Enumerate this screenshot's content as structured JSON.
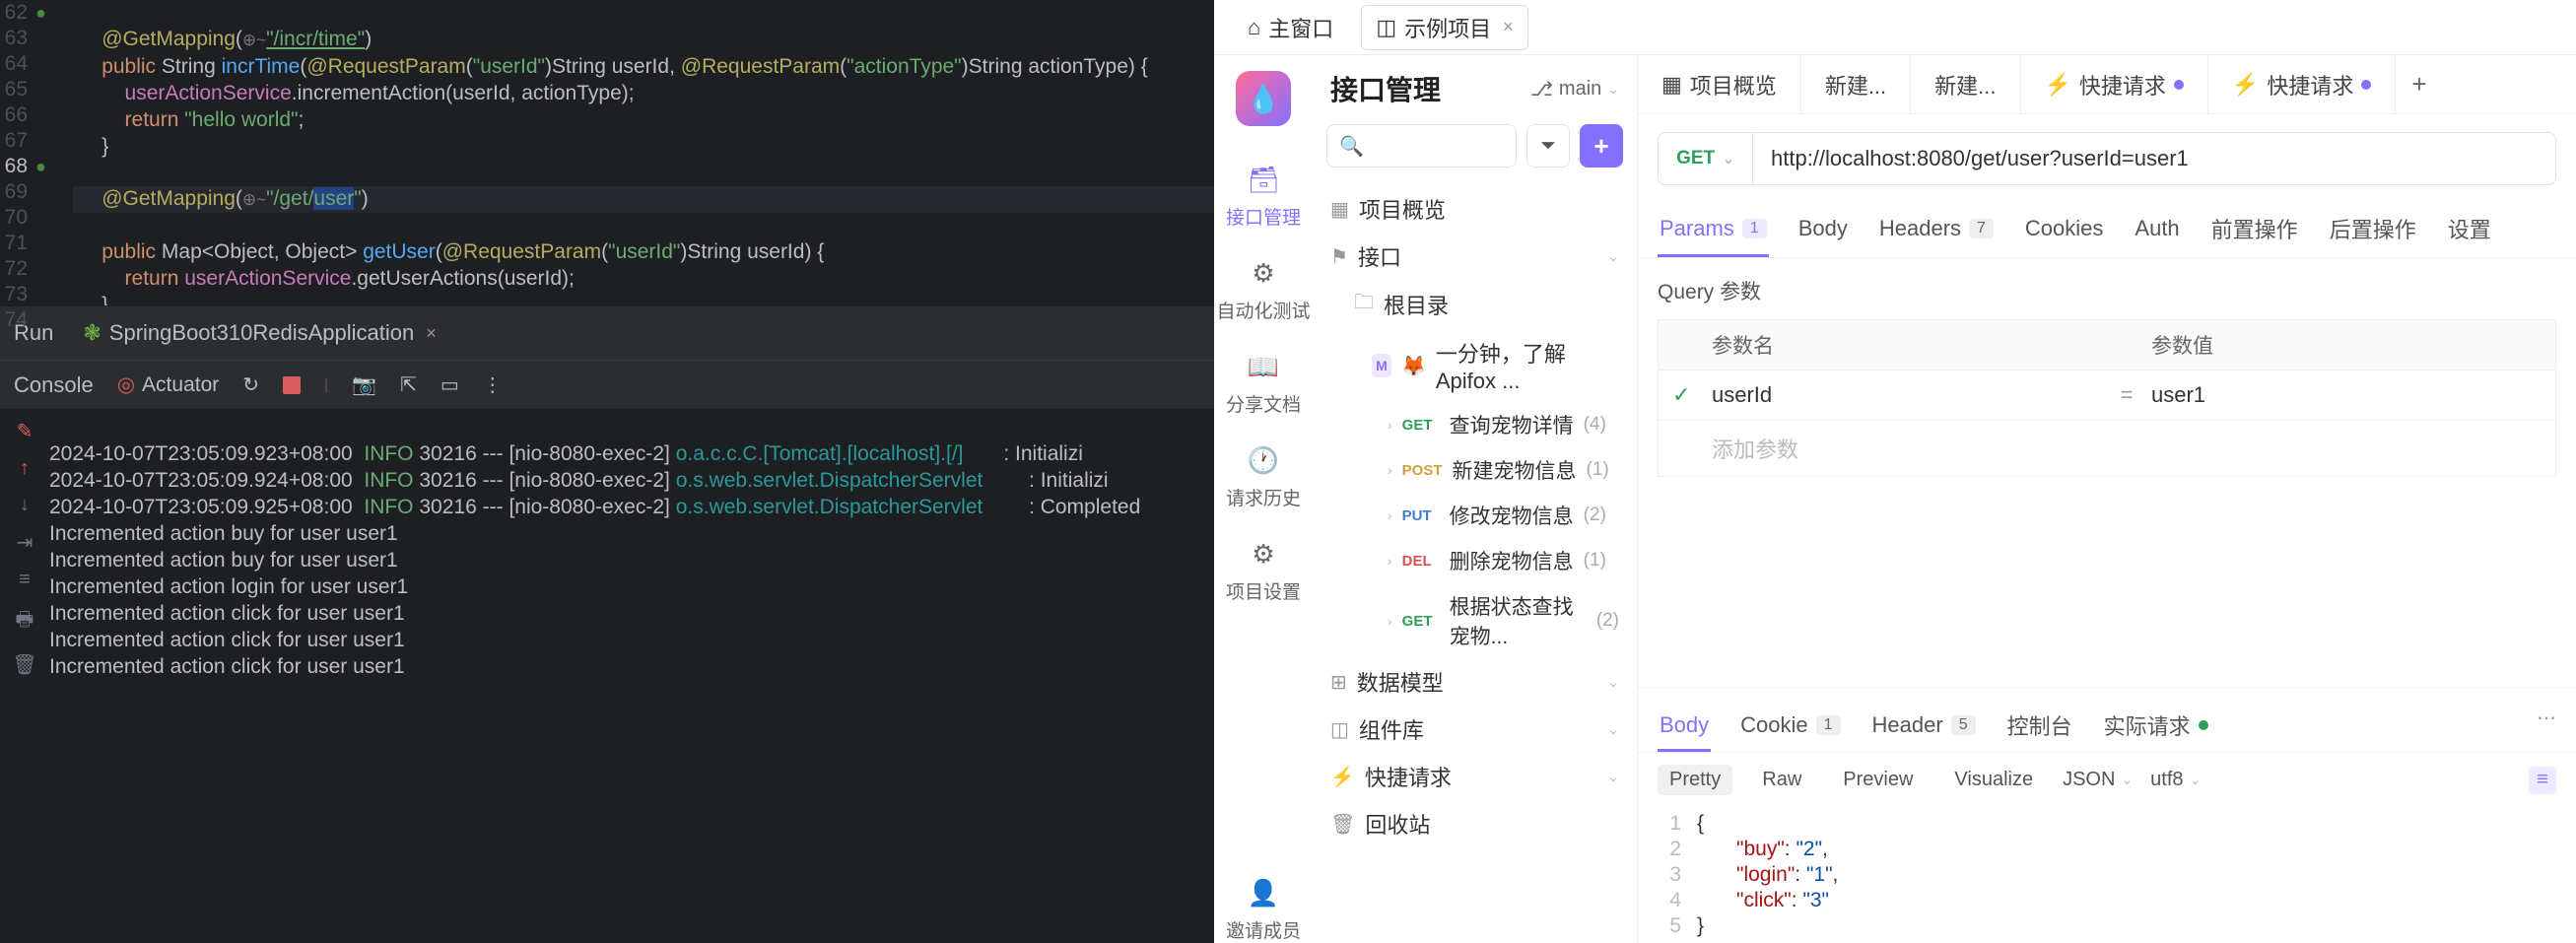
{
  "editor": {
    "lines": [
      "62",
      "63",
      "64",
      "65",
      "66",
      "67",
      "68",
      "69",
      "70",
      "71",
      "72",
      "73",
      "74"
    ],
    "code": {
      "l62": {
        "ann": "@GetMapping",
        "hint": "⊕~",
        "path": "\"/incr/time\""
      },
      "l63": {
        "kw1": "public",
        "type": "String",
        "method": "incrTime",
        "ann1": "@RequestParam",
        "p1": "\"userId\"",
        "t1": "String userId,",
        "ann2": "@RequestParam",
        "p2": "\"actionType\"",
        "t2": "String actionType) {"
      },
      "l64": {
        "field": "userActionService",
        "call": ".incrementAction(userId, actionType);"
      },
      "l65": {
        "kw": "return",
        "str": "\"hello world\"",
        "semi": ";"
      },
      "l66": "}",
      "l68": {
        "ann": "@GetMapping",
        "hint": "⊕~",
        "pre": "\"/get/",
        "sel": "user",
        "post": "\""
      },
      "l69": {
        "kw": "public",
        "type": "Map<Object, Object>",
        "method": "getUser",
        "ann": "@RequestParam",
        "p": "\"userId\"",
        "rest": "String userId) {"
      },
      "l70": {
        "kw": "return",
        "field": "userActionService",
        "call": ".getUserActions(userId);"
      },
      "l71": "}",
      "l73": "}"
    }
  },
  "run": {
    "tab": "Run",
    "app": "SpringBoot310RedisApplication"
  },
  "console_tab": "Console",
  "actuator": "Actuator",
  "logs": [
    {
      "ts": "2024-10-07T23:05:09.923+08:00",
      "lvl": "INFO",
      "pid": "30216",
      "th": "--- [nio-8080-exec-2]",
      "cls": "o.a.c.c.C.[Tomcat].[localhost].[/]",
      "msg": ": Initializi"
    },
    {
      "ts": "2024-10-07T23:05:09.924+08:00",
      "lvl": "INFO",
      "pid": "30216",
      "th": "--- [nio-8080-exec-2]",
      "cls": "o.s.web.servlet.DispatcherServlet",
      "msg": ": Initializi"
    },
    {
      "ts": "2024-10-07T23:05:09.925+08:00",
      "lvl": "INFO",
      "pid": "30216",
      "th": "--- [nio-8080-exec-2]",
      "cls": "o.s.web.servlet.DispatcherServlet",
      "msg": ": Completed "
    }
  ],
  "plain_logs": [
    "Incremented action buy for user user1",
    "Incremented action buy for user user1",
    "Incremented action login for user user1",
    "Incremented action click for user user1",
    "Incremented action click for user user1",
    "Incremented action click for user user1"
  ],
  "top_tabs": {
    "home": "主窗口",
    "project": "示例项目"
  },
  "rail": {
    "api": "接口管理",
    "auto": "自动化测试",
    "share": "分享文档",
    "history": "请求历史",
    "settings": "项目设置",
    "invite": "邀请成员"
  },
  "tree": {
    "title": "接口管理",
    "branch": "main",
    "overview": "项目概览",
    "interface": "接口",
    "root": "根目录",
    "intro": "一分钟，了解 Apifox ...",
    "ep1": {
      "m": "GET",
      "name": "查询宠物详情",
      "count": "(4)"
    },
    "ep2": {
      "m": "POST",
      "name": "新建宠物信息",
      "count": "(1)"
    },
    "ep3": {
      "m": "PUT",
      "name": "修改宠物信息",
      "count": "(2)"
    },
    "ep4": {
      "m": "DEL",
      "name": "删除宠物信息",
      "count": "(1)"
    },
    "ep5": {
      "m": "GET",
      "name": "根据状态查找宠物...",
      "count": "(2)"
    },
    "data_model": "数据模型",
    "components": "组件库",
    "quick": "快捷请求",
    "trash": "回收站"
  },
  "content_tabs": {
    "overview": "项目概览",
    "new1": "新建...",
    "new2": "新建...",
    "quick1": "快捷请求",
    "quick2": "快捷请求"
  },
  "request": {
    "method": "GET",
    "url": "http://localhost:8080/get/user?userId=user1"
  },
  "req_tabs": {
    "params": "Params",
    "params_n": "1",
    "body": "Body",
    "headers": "Headers",
    "headers_n": "7",
    "cookies": "Cookies",
    "auth": "Auth",
    "pre": "前置操作",
    "post": "后置操作",
    "settings": "设置"
  },
  "params": {
    "section": "Query 参数",
    "col_name": "参数名",
    "col_val": "参数值",
    "row_name": "userId",
    "row_val": "user1",
    "add": "添加参数"
  },
  "resp_tabs": {
    "body": "Body",
    "cookie": "Cookie",
    "cookie_n": "1",
    "header": "Header",
    "header_n": "5",
    "console": "控制台",
    "actual": "实际请求"
  },
  "resp_toolbar": {
    "pretty": "Pretty",
    "raw": "Raw",
    "preview": "Preview",
    "visualize": "Visualize",
    "format": "JSON",
    "charset": "utf8"
  },
  "json": {
    "l1": "{",
    "l2k": "\"buy\"",
    "l2v": "\"2\"",
    "l3k": "\"login\"",
    "l3v": "\"1\"",
    "l4k": "\"click\"",
    "l4v": "\"3\"",
    "l5": "}"
  }
}
